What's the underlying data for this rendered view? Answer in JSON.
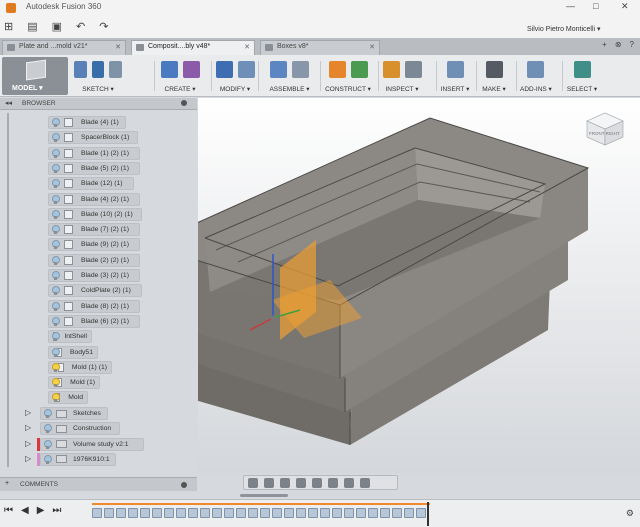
{
  "window": {
    "title": "Autodesk Fusion 360",
    "user": "Silvio Pietro Monticelli",
    "controls": [
      "—",
      "□",
      "✕"
    ]
  },
  "quick_access": {
    "grid_icon": "⊞",
    "file_icon": "▤",
    "save_icon": "▣",
    "undo_icon": "↶",
    "redo_icon": "↷"
  },
  "tabs": [
    {
      "label": "Plate and ...mold v21*",
      "active": false
    },
    {
      "label": "Composit....bly v48*",
      "active": true
    },
    {
      "label": "Boxes v8*",
      "active": false
    }
  ],
  "tab_controls": [
    "+",
    "⊗",
    "?"
  ],
  "toolbar": {
    "model": "MODEL ▾",
    "groups": [
      {
        "label": "SKETCH ▾",
        "colors": [
          "#5a80b8",
          "#3a6ea8",
          "#7f93a8"
        ]
      },
      {
        "label": "CREATE ▾",
        "colors": [
          "#4a7bc0",
          "#8b5aa8"
        ]
      },
      {
        "label": "MODIFY ▾",
        "colors": [
          "#3f6db1",
          "#6e8fb8"
        ]
      },
      {
        "label": "ASSEMBLE ▾",
        "colors": [
          "#5b86c2",
          "#8796a8"
        ]
      },
      {
        "label": "CONSTRUCT ▾",
        "colors": [
          "#e5862d",
          "#4a9a4f"
        ]
      },
      {
        "label": "INSPECT ▾",
        "colors": [
          "#d8902d",
          "#7d8896"
        ]
      },
      {
        "label": "INSERT ▾",
        "colors": [
          "#6f8fb5"
        ]
      },
      {
        "label": "MAKE ▾",
        "colors": [
          "#555b63"
        ]
      },
      {
        "label": "ADD-INS ▾",
        "colors": [
          "#6f8fb5"
        ]
      },
      {
        "label": "SELECT ▾",
        "colors": [
          "#3f8e88"
        ]
      }
    ]
  },
  "browser": {
    "title": "BROWSER",
    "back": "◂◂",
    "items": [
      {
        "label": "Blade (4) (1)",
        "type": "body"
      },
      {
        "label": "SpacerBlock (1)",
        "type": "body"
      },
      {
        "label": "Blade (1) (2) (1)",
        "type": "body"
      },
      {
        "label": "Blade (5) (2) (1)",
        "type": "body"
      },
      {
        "label": "Blade (12) (1)",
        "type": "body"
      },
      {
        "label": "Blade (4) (2) (1)",
        "type": "body"
      },
      {
        "label": "Blade (10) (2) (1)",
        "type": "body"
      },
      {
        "label": "Blade (7) (2) (1)",
        "type": "body"
      },
      {
        "label": "Blade (9) (2) (1)",
        "type": "body"
      },
      {
        "label": "Blade (2) (2) (1)",
        "type": "body"
      },
      {
        "label": "Blade (3) (2) (1)",
        "type": "body"
      },
      {
        "label": "ColdPlate (2) (1)",
        "type": "body"
      },
      {
        "label": "Blade (8) (2) (1)",
        "type": "body"
      },
      {
        "label": "Blade (6) (2) (1)",
        "type": "body"
      },
      {
        "label": "IntShell",
        "type": "body"
      },
      {
        "label": "Body51",
        "type": "body"
      },
      {
        "label": "Mold (1) (1)",
        "type": "body-visible"
      },
      {
        "label": "Mold (1)",
        "type": "body-visible"
      },
      {
        "label": "Mold",
        "type": "body-visible"
      }
    ],
    "folders": [
      {
        "label": "Sketches",
        "type": "folder"
      },
      {
        "label": "Construction",
        "type": "folder"
      },
      {
        "label": "Volume study v2:1",
        "type": "component-red"
      },
      {
        "label": "1976K910:1",
        "type": "component-pink"
      }
    ]
  },
  "comments": {
    "title": "COMMENTS"
  },
  "viewcube": {
    "label": "FRONT RIGHT"
  },
  "nav_bar": {
    "icons": [
      "orbit-icon",
      "look-icon",
      "pan-icon",
      "zoom-icon",
      "fit-icon",
      "display-icon",
      "grid-icon",
      "viewports-icon"
    ]
  },
  "timeline": {
    "controls": [
      "⏮",
      "◀",
      "▶",
      "⏭"
    ],
    "item_count": 28
  }
}
